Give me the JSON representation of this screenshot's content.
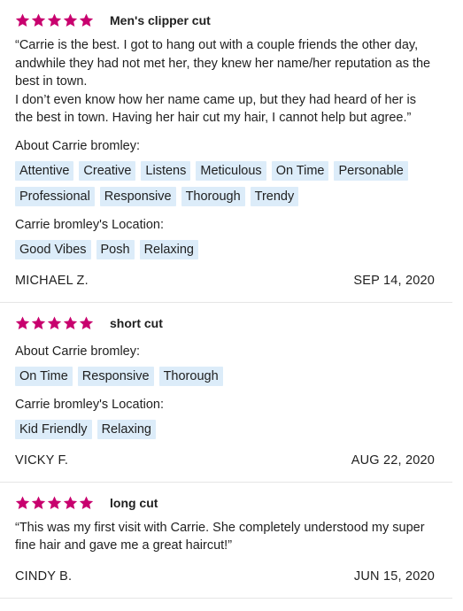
{
  "colors": {
    "star": "#c8006e",
    "tag_bg": "#dcecf9"
  },
  "reviews": [
    {
      "stars": 5,
      "service": "Men's clipper cut",
      "text": "“Carrie is the best. I got to hang out with a couple friends the other day, andwhile they had not met her, they knew her name/her reputation as the best in town.\nI don’t even know how her name came up, but they had heard of her is the best in town. Having her hair cut my hair, I cannot help but agree.”",
      "about_title": "About Carrie bromley:",
      "about_tags": [
        "Attentive",
        "Creative",
        "Listens",
        "Meticulous",
        "On Time",
        "Personable",
        "Professional",
        "Responsive",
        "Thorough",
        "Trendy"
      ],
      "location_title": "Carrie bromley's Location:",
      "location_tags": [
        "Good Vibes",
        "Posh",
        "Relaxing"
      ],
      "author": "MICHAEL Z.",
      "date": "SEP 14, 2020"
    },
    {
      "stars": 5,
      "service": "short cut",
      "about_title": "About Carrie bromley:",
      "about_tags": [
        "On Time",
        "Responsive",
        "Thorough"
      ],
      "location_title": "Carrie bromley's Location:",
      "location_tags": [
        "Kid Friendly",
        "Relaxing"
      ],
      "author": "VICKY F.",
      "date": "AUG 22, 2020"
    },
    {
      "stars": 5,
      "service": "long cut",
      "text": "“This was my first visit with Carrie. She completely understood my super fine hair and gave me a great haircut!”",
      "author": "CINDY B.",
      "date": "JUN 15, 2020"
    }
  ]
}
